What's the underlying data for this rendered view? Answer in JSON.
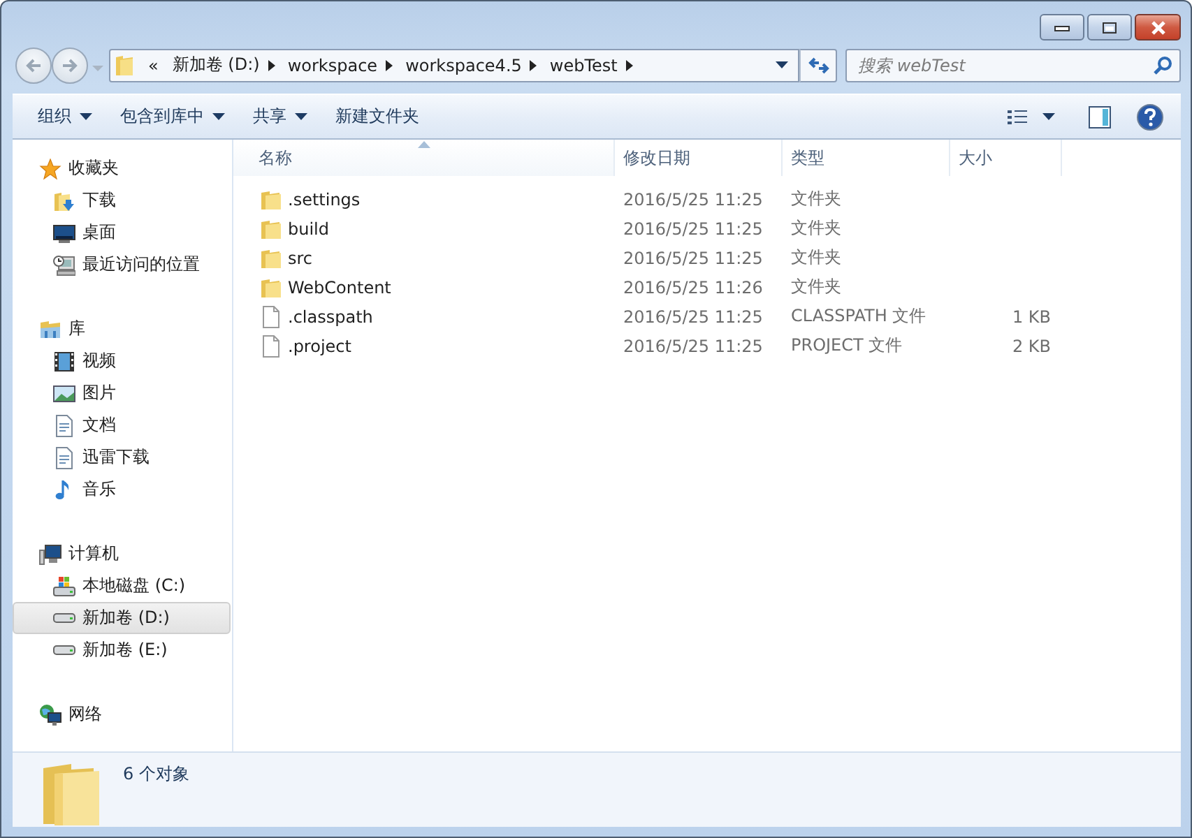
{
  "address": {
    "overflow": "«",
    "segments": [
      "新加卷 (D:)",
      "workspace",
      "workspace4.5",
      "webTest"
    ]
  },
  "search": {
    "placeholder": "搜索 webTest"
  },
  "toolbar": [
    {
      "label": "组织",
      "dropdown": true
    },
    {
      "label": "包含到库中",
      "dropdown": true
    },
    {
      "label": "共享",
      "dropdown": true
    },
    {
      "label": "新建文件夹",
      "dropdown": false
    }
  ],
  "sidebar": {
    "groups": [
      {
        "label": "收藏夹",
        "kind": "favorites",
        "selected": false,
        "children": [
          {
            "label": "下载",
            "kind": "downloads",
            "selected": false
          },
          {
            "label": "桌面",
            "kind": "desktop",
            "selected": false
          },
          {
            "label": "最近访问的位置",
            "kind": "recent",
            "selected": false
          }
        ]
      },
      {
        "label": "库",
        "kind": "libraries",
        "selected": false,
        "children": [
          {
            "label": "视频",
            "kind": "videos",
            "selected": false
          },
          {
            "label": "图片",
            "kind": "pictures",
            "selected": false
          },
          {
            "label": "文档",
            "kind": "documents",
            "selected": false
          },
          {
            "label": "迅雷下载",
            "kind": "documents",
            "selected": false
          },
          {
            "label": "音乐",
            "kind": "music",
            "selected": false
          }
        ]
      },
      {
        "label": "计算机",
        "kind": "computer",
        "selected": false,
        "children": [
          {
            "label": "本地磁盘 (C:)",
            "kind": "systemdrive",
            "selected": false
          },
          {
            "label": "新加卷 (D:)",
            "kind": "drive",
            "selected": true
          },
          {
            "label": "新加卷 (E:)",
            "kind": "drive",
            "selected": false
          }
        ]
      },
      {
        "label": "网络",
        "kind": "network",
        "selected": false
      }
    ]
  },
  "table": {
    "columns": [
      {
        "label": "名称",
        "sorted": true
      },
      {
        "label": "修改日期",
        "sorted": false
      },
      {
        "label": "类型",
        "sorted": false
      },
      {
        "label": "大小",
        "sorted": false
      }
    ],
    "rows": [
      {
        "kind": "folder",
        "name": ".settings",
        "modified": "2016/5/25 11:25",
        "type": "文件夹"
      },
      {
        "kind": "folder",
        "name": "build",
        "modified": "2016/5/25 11:25",
        "type": "文件夹"
      },
      {
        "kind": "folder",
        "name": "src",
        "modified": "2016/5/25 11:25",
        "type": "文件夹"
      },
      {
        "kind": "folder",
        "name": "WebContent",
        "modified": "2016/5/25 11:26",
        "type": "文件夹"
      },
      {
        "kind": "file",
        "name": ".classpath",
        "modified": "2016/5/25 11:25",
        "type": "CLASSPATH 文件",
        "size": "1 KB"
      },
      {
        "kind": "file",
        "name": ".project",
        "modified": "2016/5/25 11:25",
        "type": "PROJECT 文件",
        "size": "2 KB"
      }
    ]
  },
  "status_bar": {
    "count": "6 个对象"
  }
}
